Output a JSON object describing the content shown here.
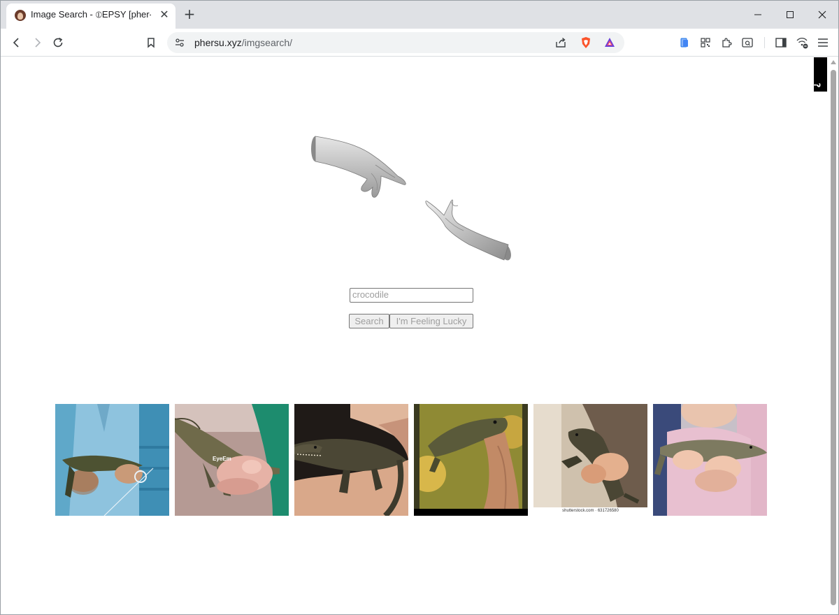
{
  "browser": {
    "tab_title": "Image Search - ⦶EPSY [pher-su:]",
    "tab_close": "✕",
    "new_tab": "+",
    "url_host": "phersu.xyz",
    "url_path": "/imgsearch/"
  },
  "page": {
    "corner_label": "?",
    "search_placeholder": "crocodile",
    "search_button": "Search",
    "lucky_button": "I'm Feeling Lucky",
    "results": [
      {
        "name": "result-1",
        "caption": ""
      },
      {
        "name": "result-2",
        "caption": "EyeEm"
      },
      {
        "name": "result-3",
        "caption": ""
      },
      {
        "name": "result-4",
        "caption": ""
      },
      {
        "name": "result-5",
        "caption": "shutterstock.com · 631726580"
      },
      {
        "name": "result-6",
        "caption": ""
      }
    ]
  },
  "colors": {
    "tabstrip": "#dfe1e5",
    "omnibox": "#f1f3f4",
    "brave_orange": "#fb542b"
  }
}
